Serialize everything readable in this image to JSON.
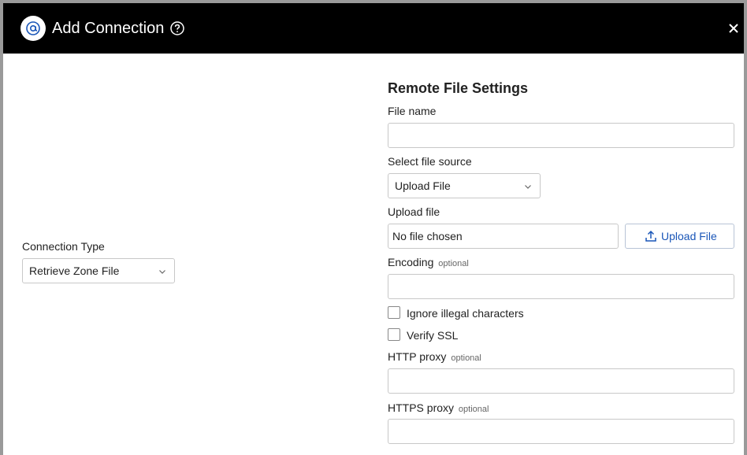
{
  "dialog": {
    "title": "Add Connection",
    "logo_icon": "at-sign-logo-icon",
    "help_icon": "help-circle-icon",
    "close_icon": "close-icon"
  },
  "connection_type": {
    "label": "Connection Type",
    "selected": "Retrieve Zone File"
  },
  "remote_file_settings": {
    "title": "Remote File Settings",
    "file_name": {
      "label": "File name",
      "value": ""
    },
    "file_source": {
      "label": "Select file source",
      "selected": "Upload File"
    },
    "upload_file": {
      "label": "Upload file",
      "status": "No file chosen",
      "button_label": "Upload File",
      "button_icon": "upload-icon"
    },
    "encoding": {
      "label": "Encoding",
      "optional": "optional",
      "value": ""
    },
    "ignore_illegal": {
      "label": "Ignore illegal characters",
      "checked": false
    },
    "verify_ssl": {
      "label": "Verify SSL",
      "checked": false
    },
    "http_proxy": {
      "label": "HTTP proxy",
      "optional": "optional",
      "value": ""
    },
    "https_proxy": {
      "label": "HTTPS proxy",
      "optional": "optional",
      "value": ""
    }
  },
  "colors": {
    "header_bg": "#000000",
    "accent": "#1a56b8",
    "border": "#c8c8c8"
  }
}
